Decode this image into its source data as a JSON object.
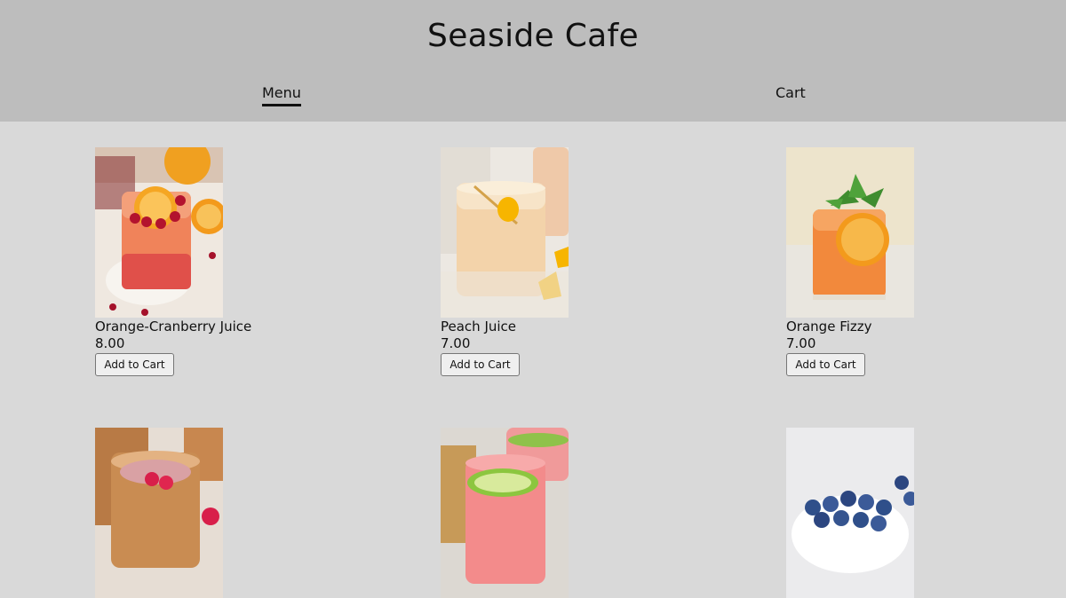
{
  "site": {
    "title": "Seaside Cafe"
  },
  "nav": {
    "menu_label": "Menu",
    "cart_label": "Cart",
    "active": "Menu"
  },
  "products": [
    {
      "name": "Orange-Cranberry Juice",
      "price": "8.00",
      "button": "Add to Cart",
      "image": "orange-cranberry-juice-photo"
    },
    {
      "name": "Peach Juice",
      "price": "7.00",
      "button": "Add to Cart",
      "image": "peach-juice-photo"
    },
    {
      "name": "Orange Fizzy",
      "price": "7.00",
      "button": "Add to Cart",
      "image": "orange-fizzy-photo"
    },
    {
      "name": "",
      "price": "",
      "button": "",
      "image": "raspberry-drink-photo"
    },
    {
      "name": "",
      "price": "",
      "button": "",
      "image": "lime-drink-photo"
    },
    {
      "name": "",
      "price": "",
      "button": "",
      "image": "blueberries-photo"
    }
  ],
  "colors": {
    "header_bg": "#bdbdbd",
    "page_bg": "#d9d9d9",
    "button_bg": "#efefef"
  }
}
